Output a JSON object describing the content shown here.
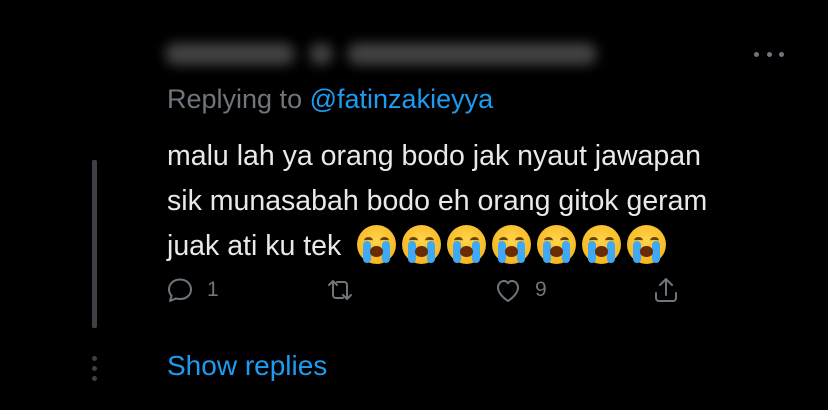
{
  "reply": {
    "replying_prefix": "Replying to",
    "replying_handle": "@fatinzakieyya",
    "text_line1": "malu lah ya orang bodo jak nyaut jawapan",
    "text_line2": "sik munasabah bodo eh orang gitok geram",
    "text_line3": "juak ati ku tek",
    "emojis": [
      "loudly-crying-face",
      "loudly-crying-face",
      "loudly-crying-face",
      "loudly-crying-face",
      "loudly-crying-face",
      "loudly-crying-face",
      "loudly-crying-face"
    ]
  },
  "actions": {
    "reply_icon": "speech-bubble-icon",
    "reply_count": "1",
    "retweet_icon": "retweet-icon",
    "like_icon": "heart-icon",
    "like_count": "9",
    "share_icon": "share-icon"
  },
  "thread": {
    "show_replies_label": "Show replies"
  },
  "colors": {
    "background": "#000000",
    "text": "#e7e9ea",
    "muted": "#6e767d",
    "link": "#1d9bf0"
  }
}
